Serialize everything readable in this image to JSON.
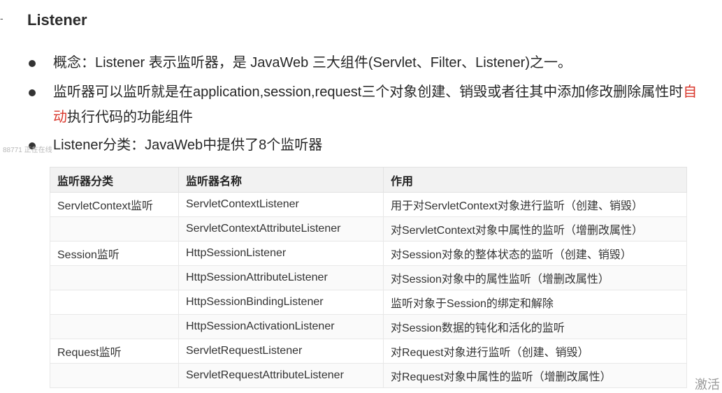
{
  "corner_mark": "-",
  "title": "Listener",
  "bullets": {
    "b1": "概念：Listener 表示监听器，是 JavaWeb 三大组件(Servlet、Filter、Listener)之一。",
    "b2_part1": "监听器可以监听就是在application,session,request三个对象创建、销毁或者往其中添加修改删除属性时",
    "b2_highlight": "自动",
    "b2_part2": "执行代码的功能组件",
    "b3": "Listener分类：JavaWeb中提供了8个监听器"
  },
  "watermark": "88771 正在在线",
  "colors": {
    "highlight": "#d9362b",
    "header_bg": "#f2f2f2"
  },
  "table": {
    "headers": [
      "监听器分类",
      "监听器名称",
      "作用"
    ],
    "rows": [
      [
        "ServletContext监听",
        "ServletContextListener",
        "用于对ServletContext对象进行监听（创建、销毁）"
      ],
      [
        "",
        "ServletContextAttributeListener",
        "对ServletContext对象中属性的监听（增删改属性）"
      ],
      [
        "Session监听",
        "HttpSessionListener",
        "对Session对象的整体状态的监听（创建、销毁）"
      ],
      [
        "",
        "HttpSessionAttributeListener",
        "对Session对象中的属性监听（增删改属性）"
      ],
      [
        "",
        "HttpSessionBindingListener",
        "监听对象于Session的绑定和解除"
      ],
      [
        "",
        "HttpSessionActivationListener",
        "对Session数据的钝化和活化的监听"
      ],
      [
        "Request监听",
        "ServletRequestListener",
        "对Request对象进行监听（创建、销毁）"
      ],
      [
        "",
        "ServletRequestAttributeListener",
        "对Request对象中属性的监听（增删改属性）"
      ]
    ]
  },
  "activate_text": "激活"
}
